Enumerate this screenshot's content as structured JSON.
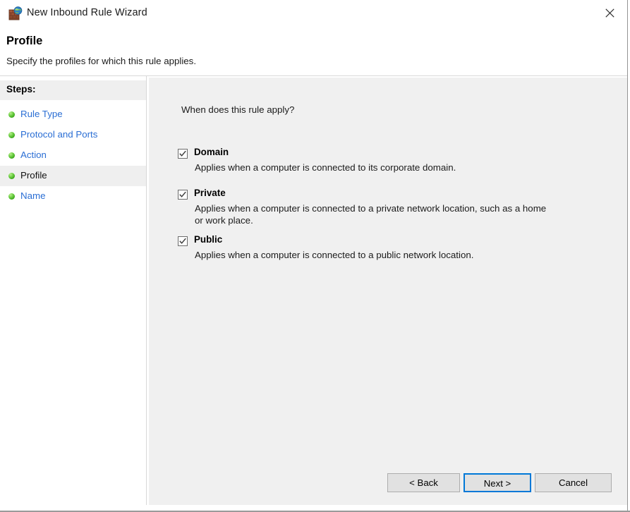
{
  "window": {
    "title": "New Inbound Rule Wizard",
    "icon": "firewall-globe-icon",
    "close_label": "✕"
  },
  "header": {
    "title": "Profile",
    "subtitle": "Specify the profiles for which this rule applies."
  },
  "sidebar": {
    "heading": "Steps:",
    "items": [
      {
        "label": "Rule Type",
        "current": false
      },
      {
        "label": "Protocol and Ports",
        "current": false
      },
      {
        "label": "Action",
        "current": false
      },
      {
        "label": "Profile",
        "current": true
      },
      {
        "label": "Name",
        "current": false
      }
    ]
  },
  "main": {
    "question": "When does this rule apply?",
    "options": [
      {
        "label": "Domain",
        "checked": true,
        "description": "Applies when a computer is connected to its corporate domain."
      },
      {
        "label": "Private",
        "checked": true,
        "description": "Applies when a computer is connected to a private network location, such as a home or work place."
      },
      {
        "label": "Public",
        "checked": true,
        "description": "Applies when a computer is connected to a public network location."
      }
    ]
  },
  "footer": {
    "back_label": "< Back",
    "next_label": "Next >",
    "cancel_label": "Cancel"
  },
  "colors": {
    "link": "#2a6ed4",
    "panel": "#f0f0f0",
    "focus": "#0078d7",
    "bullet_green": "#4cb82b"
  }
}
